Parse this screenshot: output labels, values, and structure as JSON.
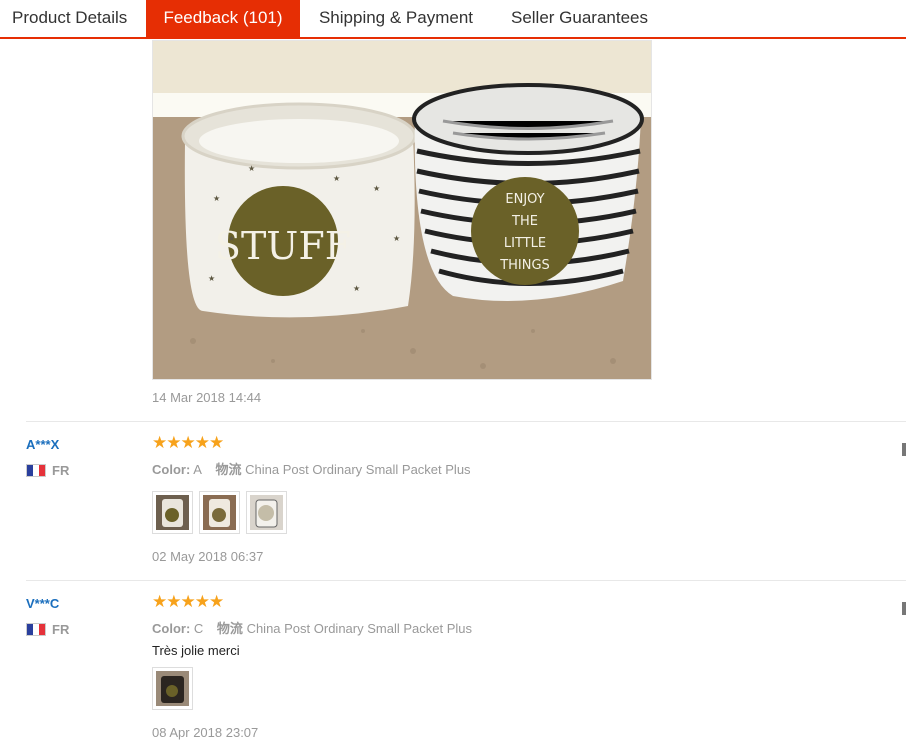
{
  "tabs": {
    "details": "Product Details",
    "feedback": "Feedback (101)",
    "shipping": "Shipping & Payment",
    "guarantees": "Seller Guarantees"
  },
  "photo": {
    "left_basket_print": "STUFF",
    "right_basket_print": [
      "ENJOY",
      "THE",
      "LITTLE",
      "THINGS"
    ]
  },
  "previous_review": {
    "date": "14 Mar 2018 14:44"
  },
  "reviews": [
    {
      "user": "A***X",
      "country": "FR",
      "stars": "★★★★★",
      "rating": 5,
      "color_label": "Color:",
      "color_value": "A",
      "logistics_label": "物流",
      "logistics_value": "China Post Ordinary Small Packet Plus",
      "comment": "",
      "photo_count": 3,
      "date": "02 May 2018 06:37"
    },
    {
      "user": "V***C",
      "country": "FR",
      "stars": "★★★★★",
      "rating": 5,
      "color_label": "Color:",
      "color_value": "C",
      "logistics_label": "物流",
      "logistics_value": "China Post Ordinary Small Packet Plus",
      "comment": "Très jolie merci",
      "photo_count": 1,
      "date": "08 Apr 2018 23:07"
    }
  ],
  "colors": {
    "accent": "#e62e04",
    "star": "#f7a21b",
    "username": "#1a6ebd"
  }
}
